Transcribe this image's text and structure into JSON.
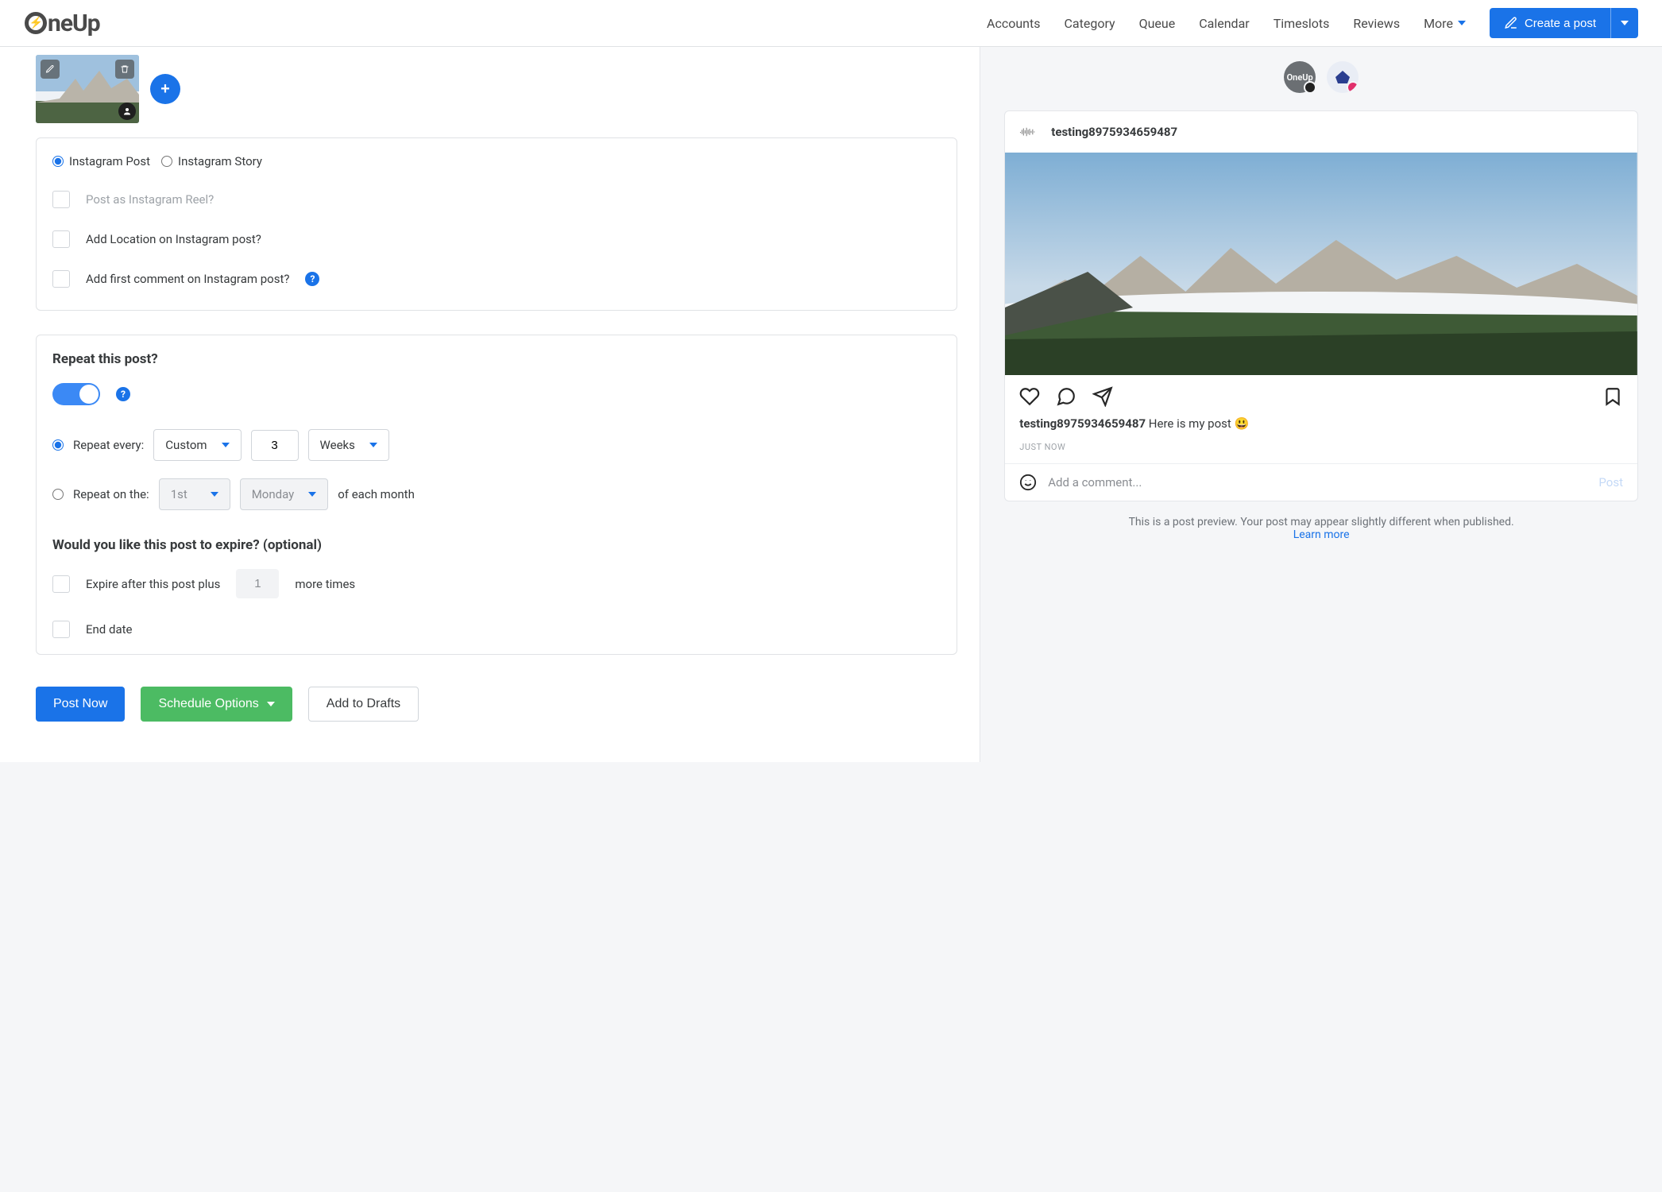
{
  "brand": "OneUp",
  "nav": {
    "accounts": "Accounts",
    "category": "Category",
    "queue": "Queue",
    "calendar": "Calendar",
    "timeslots": "Timeslots",
    "reviews": "Reviews",
    "more": "More"
  },
  "create_post_label": "Create a post",
  "post_type": {
    "post": "Instagram Post",
    "story": "Instagram Story"
  },
  "options": {
    "reel": "Post as Instagram Reel?",
    "location": "Add Location on Instagram post?",
    "first_comment": "Add first comment on Instagram post?"
  },
  "repeat": {
    "title": "Repeat this post?",
    "every_label": "Repeat every:",
    "every_mode": "Custom",
    "every_value": "3",
    "every_unit": "Weeks",
    "on_label": "Repeat on the:",
    "on_ordinal": "1st",
    "on_day": "Monday",
    "on_suffix": "of each month"
  },
  "expire": {
    "title": "Would you like this post to expire? (optional)",
    "after_prefix": "Expire after this post plus",
    "after_value": "1",
    "after_suffix": "more times",
    "end_date": "End date"
  },
  "actions": {
    "post_now": "Post Now",
    "schedule": "Schedule Options",
    "drafts": "Add to Drafts"
  },
  "preview": {
    "avatar1_text": "OneUp",
    "handle": "testing8975934659487",
    "caption_user": "testing8975934659487",
    "caption_text": "Here is my post",
    "emoji": "😃",
    "time": "JUST NOW",
    "comment_placeholder": "Add a comment...",
    "post_link": "Post",
    "note_line1": "This is a post preview. Your post may appear slightly different when published.",
    "learn_more": "Learn more"
  }
}
